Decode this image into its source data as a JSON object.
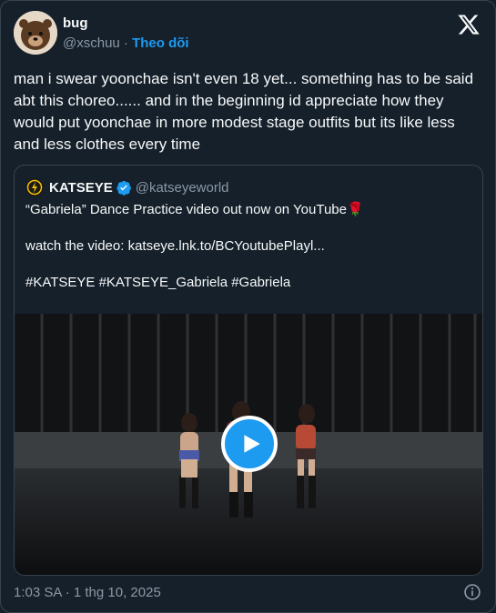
{
  "author": {
    "display_name": "bug",
    "handle": "@xschuu",
    "separator": " · ",
    "follow_label": "Theo dõi"
  },
  "tweet": {
    "text": "man i swear yoonchae isn't even 18 yet... something has to be said abt this choreo...... and in the beginning id appreciate how they would put yoonchae in more modest stage outfits but its like less and less clothes every time"
  },
  "quoted": {
    "display_name": "KATSEYE",
    "handle": "@katseyeworld",
    "line1": "“Gabriela” Dance Practice video out now on YouTube",
    "line1_emoji": "🌹",
    "line2": "watch the video: katseye.lnk.to/BCYoutubePlayl...",
    "line3": "#KATSEYE #KATSEYE_Gabriela #Gabriela"
  },
  "footer": {
    "timestamp": "1:03 SA · 1 thg 10, 2025"
  },
  "colors": {
    "background": "#15202b",
    "accent": "#1d9bf0",
    "muted": "#8b98a5",
    "border": "#38444d"
  },
  "icons": [
    "x-logo-icon",
    "verified-icon",
    "play-icon",
    "info-icon"
  ]
}
